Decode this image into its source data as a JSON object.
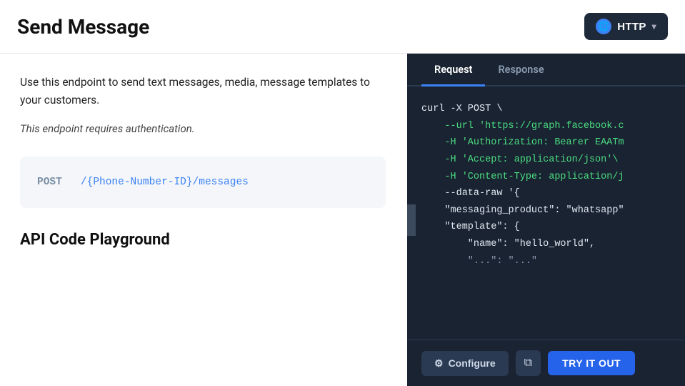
{
  "header": {
    "title": "Send Message",
    "dropdown_label": "HTTP",
    "globe_icon": "🌐"
  },
  "left": {
    "description": "Use this endpoint to send text messages, media, message templates to your customers.",
    "auth_note": "This endpoint requires authentication.",
    "code_method": "POST",
    "code_path": "/{Phone-Number-ID}/messages",
    "section_title": "API Code Playground"
  },
  "right": {
    "tabs": [
      {
        "label": "Request",
        "active": true
      },
      {
        "label": "Response",
        "active": false
      }
    ],
    "code_lines": [
      {
        "text": "curl -X POST \\",
        "style": "white"
      },
      {
        "text": "    --url 'https://graph.facebook.c",
        "style": "green"
      },
      {
        "text": "    -H 'Authorization: Bearer EAATm",
        "style": "green"
      },
      {
        "text": "    -H 'Accept: application/json'\\",
        "style": "green"
      },
      {
        "text": "    -H 'Content-Type: application/j",
        "style": "green"
      },
      {
        "text": "    --data-raw '{",
        "style": "white"
      },
      {
        "text": "    \"messaging_product\": \"whatsapp\"",
        "style": "white"
      },
      {
        "text": "    \"template\": {",
        "style": "white"
      },
      {
        "text": "        \"name\": \"hello_world\",",
        "style": "white"
      },
      {
        "text": "        \"...\": \"...\"",
        "style": "gray"
      }
    ],
    "configure_label": "Configure",
    "try_label": "TRY IT OUT",
    "copy_icon": "⧉",
    "gear_icon": "⚙"
  }
}
